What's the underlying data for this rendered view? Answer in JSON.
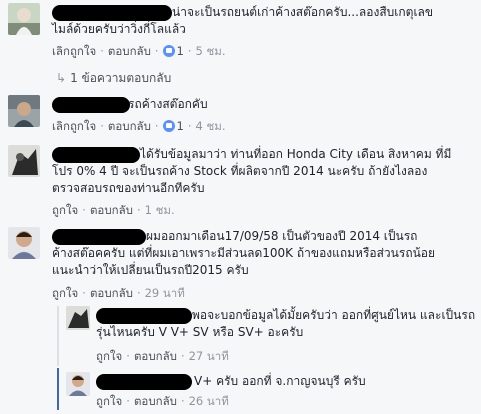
{
  "comments": [
    {
      "text": "น่าจะเป็นรถยนต์เก่าค้างสต๊อกครับ...ลองสืบเกตุเลข\nไมล์ด้วยครับว่าวิ่งกี่โลแล้ว",
      "like": "เลิกถูกใจ",
      "reply": "ตอบกลับ",
      "likes_count": "1",
      "time": "5 ชม.",
      "replies_link": "1 ข้อความตอบกลับ"
    },
    {
      "text": "รถค้างสต๊อกคับ",
      "like": "เลิกถูกใจ",
      "reply": "ตอบกลับ",
      "likes_count": "1",
      "time": "4 ชม."
    },
    {
      "text": "ได้รับข้อมูลมาว่า ท่านที่ออก Honda City เดือน สิงหาคม ที่มี\nโปร 0% 4 ปี จะเป็นรถค้าง Stock ที่ผลิตจากปี 2014 นะครับ ถ้ายังไงลอง\nตรวจสอบรถของท่านอีกทีครับ",
      "like": "ถูกใจ",
      "reply": "ตอบกลับ",
      "time": "1 ชม."
    },
    {
      "text": "ผมออกมาเดือน17/09/58 เป็นตัวของปี 2014 เป็นรถ\nค้างสต๊อคครับ แต่ที่ผมเอาเพราะมีส่วนลด100K ถ้าของแถมหรือส่วนรถน้อย\nแนะนำว่าให้เปลี่ยนเป็นรถปี2015 ครับ",
      "like": "ถูกใจ",
      "reply": "ตอบกลับ",
      "time": "29 นาที"
    },
    {
      "text": "พอจะบอกข้อมูลได้มั้ยครับว่า ออกที่ศูนย์ไหน และเป็นรถ\nรุ่นไหนครับ V V+ SV หรือ SV+ อะครับ",
      "like": "ถูกใจ",
      "reply": "ตอบกลับ",
      "time": "27 นาที"
    },
    {
      "text": "V+ ครับ ออกที่ จ.กาญจนบุรี ครับ",
      "like": "ถูกใจ",
      "reply": "ตอบกลับ",
      "time": "26 นาที"
    }
  ],
  "colors": {
    "link": "#365899",
    "meta": "#90949c",
    "like_blue": "#5890ff",
    "thread_active": "#4267b2"
  }
}
